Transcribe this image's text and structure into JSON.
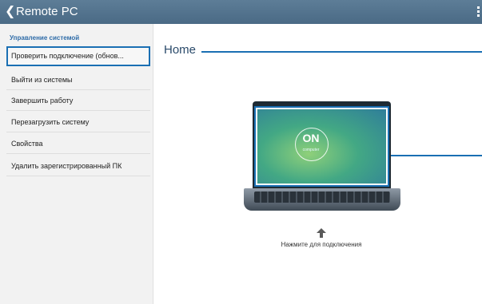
{
  "titlebar": {
    "back_icon": "chevron-left-icon",
    "title": "Remote PC",
    "more_icon": "overflow-menu-icon"
  },
  "sidebar": {
    "header": "Управление системой",
    "items": [
      {
        "label": "Проверить подключение (обнов..."
      },
      {
        "label": "Выйти из системы"
      },
      {
        "label": "Завершить работу"
      },
      {
        "label": "Перезагрузить систему"
      },
      {
        "label": "Свойства"
      },
      {
        "label": "Удалить зарегистрированный ПК"
      }
    ]
  },
  "main": {
    "home_title": "Home",
    "on_label": "ON",
    "on_sublabel": "computer",
    "connect_hint": "Нажмите для подключения"
  },
  "colors": {
    "titlebar": "#4f6f8a",
    "accent": "#1a6fb3",
    "sidebar_bg": "#f2f2f2"
  }
}
